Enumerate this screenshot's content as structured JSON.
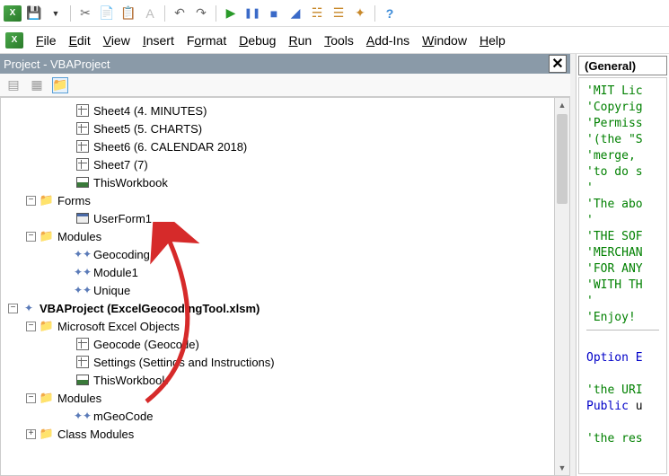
{
  "toolbar1_icons": [
    "excel",
    "save",
    "dropdown",
    "sep",
    "cut",
    "copy",
    "paste",
    "brush",
    "sep",
    "undo",
    "redo",
    "sep",
    "run",
    "pause",
    "stop",
    "design",
    "sep",
    "props",
    "objbrowser",
    "toolbox",
    "sep",
    "help"
  ],
  "menu": {
    "items": [
      {
        "label": "File",
        "u": "F"
      },
      {
        "label": "Edit",
        "u": "E"
      },
      {
        "label": "View",
        "u": "V"
      },
      {
        "label": "Insert",
        "u": "I"
      },
      {
        "label": "Format",
        "u": "o"
      },
      {
        "label": "Debug",
        "u": "D"
      },
      {
        "label": "Run",
        "u": "R"
      },
      {
        "label": "Tools",
        "u": "T"
      },
      {
        "label": "Add-Ins",
        "u": "A"
      },
      {
        "label": "Window",
        "u": "W"
      },
      {
        "label": "Help",
        "u": "H"
      }
    ]
  },
  "project_panel": {
    "title": "Project - VBAProject",
    "tree": [
      {
        "indent": 3,
        "icon": "sheet",
        "label": "Sheet4 (4. MINUTES)"
      },
      {
        "indent": 3,
        "icon": "sheet",
        "label": "Sheet5 (5. CHARTS)"
      },
      {
        "indent": 3,
        "icon": "sheet",
        "label": "Sheet6 (6. CALENDAR 2018)"
      },
      {
        "indent": 3,
        "icon": "sheet",
        "label": "Sheet7 (7)"
      },
      {
        "indent": 3,
        "icon": "wb",
        "label": "ThisWorkbook"
      },
      {
        "indent": 1,
        "expander": "-",
        "icon": "folder",
        "label": "Forms"
      },
      {
        "indent": 3,
        "icon": "form",
        "label": "UserForm1"
      },
      {
        "indent": 1,
        "expander": "-",
        "icon": "folder",
        "label": "Modules"
      },
      {
        "indent": 3,
        "icon": "mod",
        "label": "Geocoding"
      },
      {
        "indent": 3,
        "icon": "mod",
        "label": "Module1"
      },
      {
        "indent": 3,
        "icon": "mod",
        "label": "Unique"
      },
      {
        "indent": 0,
        "expander": "-",
        "icon": "vba",
        "label": "VBAProject (ExcelGeocodingTool.xlsm)",
        "bold": true
      },
      {
        "indent": 1,
        "expander": "-",
        "icon": "folder",
        "label": "Microsoft Excel Objects"
      },
      {
        "indent": 3,
        "icon": "sheet",
        "label": "Geocode (Geocode)"
      },
      {
        "indent": 3,
        "icon": "sheet",
        "label": "Settings (Settings and Instructions)"
      },
      {
        "indent": 3,
        "icon": "wb",
        "label": "ThisWorkbook"
      },
      {
        "indent": 1,
        "expander": "-",
        "icon": "folder",
        "label": "Modules"
      },
      {
        "indent": 3,
        "icon": "mod",
        "label": "mGeoCode"
      },
      {
        "indent": 1,
        "expander": "+",
        "icon": "folder",
        "label": "Class Modules"
      }
    ]
  },
  "code_panel": {
    "dropdown": "(General)",
    "lines": [
      {
        "cls": "green",
        "text": "'MIT Lic"
      },
      {
        "cls": "green",
        "text": "'Copyrig"
      },
      {
        "cls": "green",
        "text": "'Permiss"
      },
      {
        "cls": "green",
        "text": "'(the \"S"
      },
      {
        "cls": "green",
        "text": "'merge,"
      },
      {
        "cls": "green",
        "text": "'to do s"
      },
      {
        "cls": "green",
        "text": "'"
      },
      {
        "cls": "green",
        "text": "'The abo"
      },
      {
        "cls": "green",
        "text": "'"
      },
      {
        "cls": "green",
        "text": "'THE SOF"
      },
      {
        "cls": "green",
        "text": "'MERCHAN"
      },
      {
        "cls": "green",
        "text": "'FOR ANY"
      },
      {
        "cls": "green",
        "text": "'WITH TH"
      },
      {
        "cls": "green",
        "text": "'"
      },
      {
        "cls": "green",
        "text": "'Enjoy!"
      },
      {
        "cls": "",
        "text": ""
      },
      {
        "cls": "blue",
        "text": "Option E"
      },
      {
        "cls": "",
        "text": ""
      },
      {
        "cls": "green",
        "text": "'the URI"
      },
      {
        "cls": "mix",
        "prefix": "Public",
        "prefix_cls": "blue",
        "rest": " u"
      },
      {
        "cls": "",
        "text": ""
      },
      {
        "cls": "green",
        "text": "'the res"
      }
    ]
  }
}
